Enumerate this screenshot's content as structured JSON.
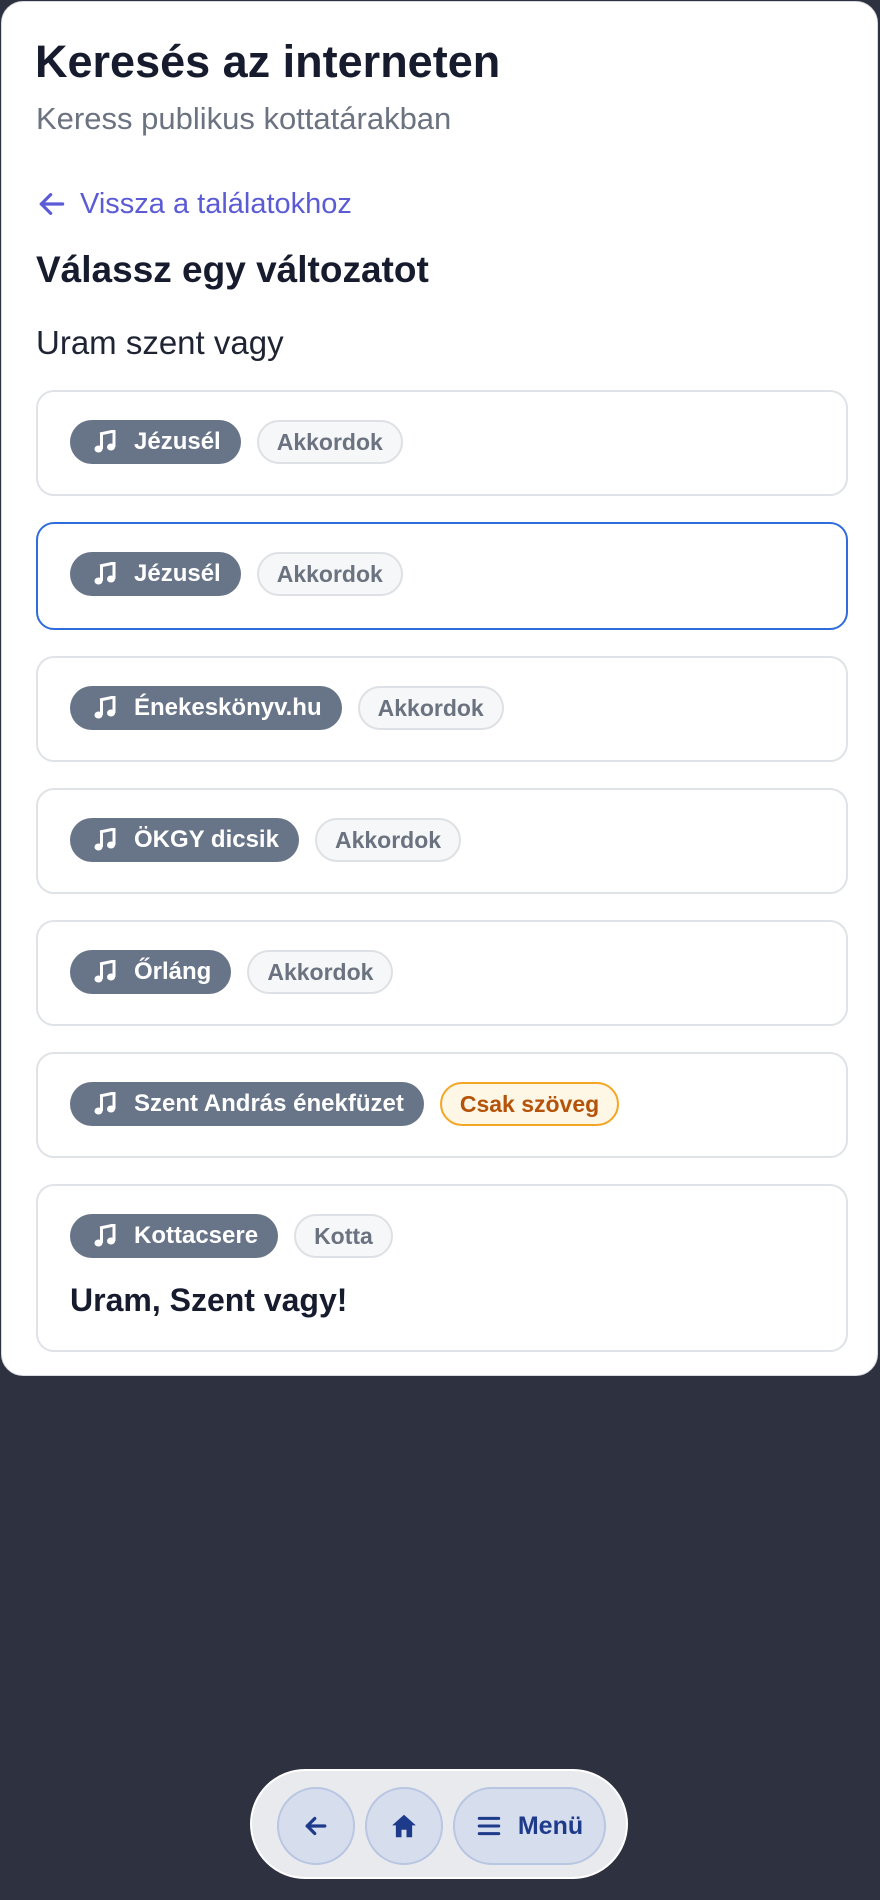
{
  "header": {
    "title": "Keresés az interneten",
    "subtitle": "Keress publikus kottatárakban"
  },
  "back_link": {
    "label": "Vissza a találatokhoz",
    "icon": "arrow-left-icon"
  },
  "section": {
    "title": "Válassz egy változatot",
    "song": "Uram szent vagy"
  },
  "results": [
    {
      "source": "Jézusél",
      "type": "Akkordok",
      "type_style": "neutral",
      "selected": false
    },
    {
      "source": "Jézusél",
      "type": "Akkordok",
      "type_style": "neutral",
      "selected": true
    },
    {
      "source": "Énekeskönyv.hu",
      "type": "Akkordok",
      "type_style": "neutral",
      "selected": false
    },
    {
      "source": "ÖKGY dicsik",
      "type": "Akkordok",
      "type_style": "neutral",
      "selected": false
    },
    {
      "source": "Őrláng",
      "type": "Akkordok",
      "type_style": "neutral",
      "selected": false
    },
    {
      "source": "Szent András énekfüzet",
      "type": "Csak szöveg",
      "type_style": "warning",
      "selected": false
    },
    {
      "source": "Kottacsere",
      "type": "Kotta",
      "type_style": "neutral",
      "selected": false,
      "title": "Uram, Szent vagy!"
    }
  ],
  "bottom_nav": {
    "back_icon": "arrow-left-icon",
    "home_icon": "home-icon",
    "menu_icon": "hamburger-menu-icon",
    "menu_label": "Menü"
  },
  "colors": {
    "background": "#2e3140",
    "accent_link": "#5b5bd6",
    "source_badge": "#687487",
    "selected_border": "#2f6cdc",
    "warning_badge_border": "#f5a524",
    "warning_badge_text": "#b45309",
    "nav_button": "#d6deed"
  }
}
